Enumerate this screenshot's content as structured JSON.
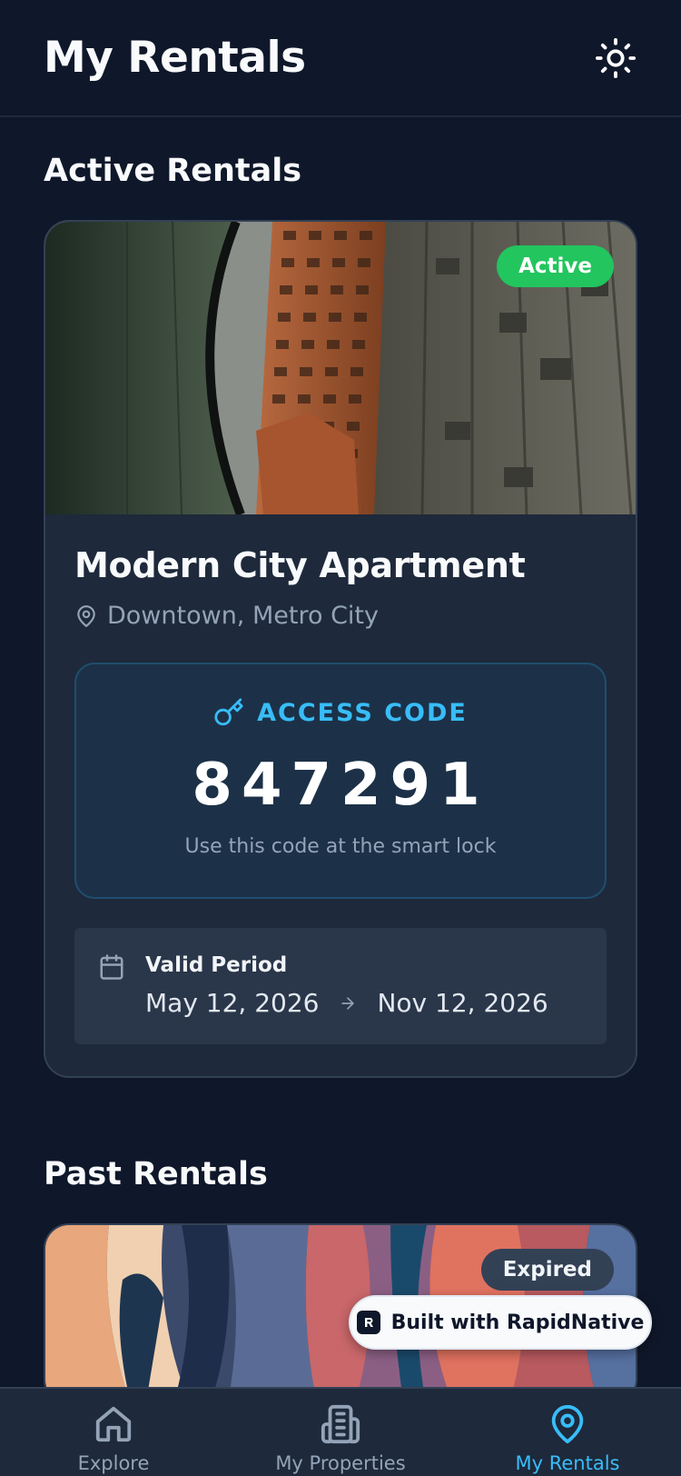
{
  "header": {
    "title": "My Rentals",
    "theme_icon": "sun-icon"
  },
  "sections": {
    "active_title": "Active Rentals",
    "past_title": "Past Rentals"
  },
  "active_rental": {
    "status": "Active",
    "status_color": "#22c55e",
    "title": "Modern City Apartment",
    "location": "Downtown, Metro City",
    "access_label": "ACCESS CODE",
    "access_code": "847291",
    "access_hint": "Use this code at the smart lock",
    "validity_label": "Valid Period",
    "start_date": "May 12, 2026",
    "end_date": "Nov 12, 2026"
  },
  "past_rental": {
    "status": "Expired"
  },
  "built_with": {
    "label": "Built with RapidNative"
  },
  "nav": {
    "items": [
      {
        "label": "Explore",
        "icon": "home-icon",
        "active": false
      },
      {
        "label": "My Properties",
        "icon": "building-icon",
        "active": false
      },
      {
        "label": "My Rentals",
        "icon": "map-pin-icon",
        "active": true
      }
    ]
  },
  "colors": {
    "background": "#0f172a",
    "card": "#1e293b",
    "accent": "#38bdf8",
    "active_badge": "#22c55e"
  }
}
